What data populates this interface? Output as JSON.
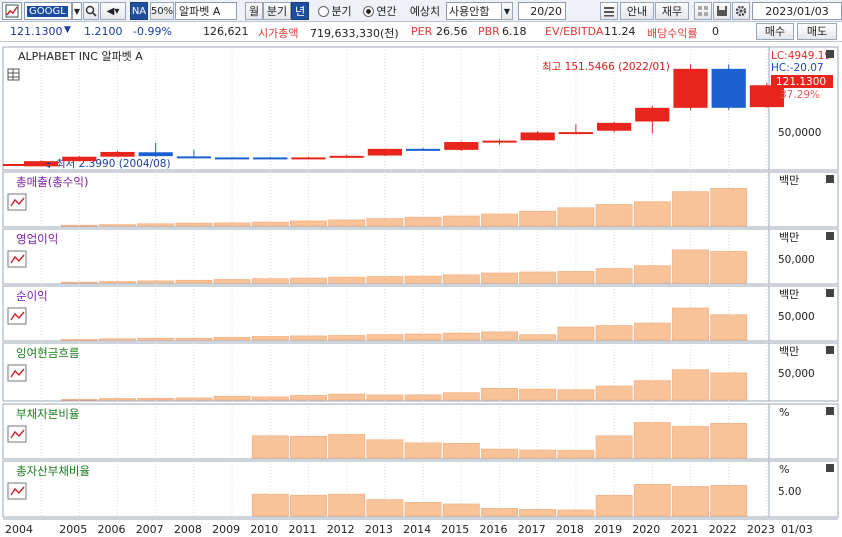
{
  "toolbar": {
    "ticker": "GOOGL",
    "na_label": "NA",
    "pct_label": "50%",
    "company": "알파벳 A",
    "month_label": "월",
    "quarter_label": "분기",
    "year_label": "년",
    "radio_quarter": "분기",
    "radio_annual": "연간",
    "forecast_label": "예상치",
    "forecast_select": "사용안함",
    "page_count": "20/20",
    "guide_label": "안내",
    "finance_label": "재무",
    "date": "2023/01/03"
  },
  "info": {
    "price": "121.1300",
    "change": "1.2100",
    "change_pct": "-0.99%",
    "volume": "126,621",
    "market_cap_label": "시가총액",
    "market_cap": "719,633,330(천)",
    "per_label": "PER",
    "per": "26.56",
    "pbr_label": "PBR",
    "pbr": "6.18",
    "ev_label": "EV/EBITDA",
    "ev": "11.24",
    "div_label": "배당수익률",
    "div": "0",
    "buy_label": "매수",
    "sell_label": "매도"
  },
  "chart": {
    "title": "ALPHABET INC 알파벳 A",
    "lc": "LC:4949.19",
    "hc": "HC:-20.07",
    "high_label": "최고 151.5466 (2022/01)",
    "low_label": "최저 2.3990 (2004/08)",
    "price_tag": "121.1300",
    "pct_tag": "37.29%",
    "axis_label": "50,0000"
  },
  "colors": {
    "up": "#e8251c",
    "down": "#1c5fd1",
    "bar": "#f9c39a",
    "bar_stroke": "#f2a978",
    "panel_title": "#7b1fa2",
    "panel_title_green": "#1b7d1b"
  },
  "chart_data": [
    {
      "type": "bar",
      "name": "candles",
      "x": [
        "2004",
        "2005",
        "2006",
        "2007",
        "2008",
        "2009",
        "2010",
        "2011",
        "2012",
        "2013",
        "2014",
        "2015",
        "2016",
        "2017",
        "2018",
        "2019",
        "2020",
        "2021",
        "2022",
        "2023"
      ],
      "open": [
        2.4,
        10.0,
        16.5,
        23.0,
        17.0,
        15.5,
        15.5,
        15.0,
        15.5,
        18.2,
        28.0,
        26.5,
        38.0,
        40.5,
        52.0,
        54.5,
        68.0,
        88.0,
        145.0,
        89.0
      ],
      "close": [
        10.0,
        16.5,
        23.5,
        17.3,
        15.5,
        14.9,
        14.9,
        15.5,
        17.8,
        28.0,
        26.5,
        38.0,
        40.0,
        52.0,
        52.5,
        66.0,
        88.0,
        145.0,
        88.0,
        121.0
      ],
      "high": [
        11.0,
        17.5,
        25.0,
        37.0,
        26.5,
        16.0,
        16.0,
        16.5,
        19.5,
        28.0,
        29.5,
        39.0,
        42.0,
        54.0,
        64.0,
        68.0,
        91.0,
        151.5,
        151.5,
        125.0
      ],
      "low": [
        2.399,
        9.5,
        15.5,
        16.0,
        15.0,
        14.0,
        14.0,
        14.0,
        15.0,
        17.5,
        25.0,
        25.0,
        34.0,
        40.0,
        49.0,
        52.0,
        50.5,
        85.0,
        85.0,
        88.0
      ]
    },
    {
      "type": "bar",
      "name": "총매출(총수익)",
      "unit": "백만",
      "x": [
        "2005",
        "2006",
        "2007",
        "2008",
        "2009",
        "2010",
        "2011",
        "2012",
        "2013",
        "2014",
        "2015",
        "2016",
        "2017",
        "2018",
        "2019",
        "2020",
        "2021",
        "2022"
      ],
      "values": [
        6139,
        10605,
        16594,
        21796,
        23651,
        29321,
        37905,
        46039,
        55519,
        66001,
        74989,
        90272,
        110855,
        136819,
        161857,
        182527,
        257637,
        282836
      ]
    },
    {
      "type": "bar",
      "name": "영업이익",
      "unit": "백만",
      "tick": "50,000",
      "x": [
        "2005",
        "2006",
        "2007",
        "2008",
        "2009",
        "2010",
        "2011",
        "2012",
        "2013",
        "2014",
        "2015",
        "2016",
        "2017",
        "2018",
        "2019",
        "2020",
        "2021",
        "2022"
      ],
      "values": [
        2017,
        3550,
        5084,
        6632,
        8312,
        10381,
        11742,
        13834,
        15403,
        16496,
        19360,
        23716,
        26146,
        27524,
        34231,
        41224,
        78714,
        74842
      ]
    },
    {
      "type": "bar",
      "name": "순이익",
      "unit": "백만",
      "tick": "50,000",
      "x": [
        "2005",
        "2006",
        "2007",
        "2008",
        "2009",
        "2010",
        "2011",
        "2012",
        "2013",
        "2014",
        "2015",
        "2016",
        "2017",
        "2018",
        "2019",
        "2020",
        "2021",
        "2022"
      ],
      "values": [
        1465,
        3077,
        4204,
        4227,
        6520,
        8505,
        9737,
        10737,
        12920,
        14136,
        16348,
        19478,
        12662,
        30736,
        34343,
        40269,
        76033,
        59972
      ]
    },
    {
      "type": "bar",
      "name": "잉여현금흐름",
      "unit": "백만",
      "tick": "50,000",
      "x": [
        "2005",
        "2006",
        "2007",
        "2008",
        "2009",
        "2010",
        "2011",
        "2012",
        "2013",
        "2014",
        "2015",
        "2016",
        "2017",
        "2018",
        "2019",
        "2020",
        "2021",
        "2022"
      ],
      "values": [
        1660,
        3400,
        3770,
        4560,
        8460,
        7140,
        9990,
        13210,
        11310,
        11420,
        16110,
        25820,
        23910,
        22830,
        30970,
        42840,
        67010,
        60010
      ]
    },
    {
      "type": "bar",
      "name": "부채자본비율",
      "unit": "%",
      "x": [
        "2010",
        "2011",
        "2012",
        "2013",
        "2014",
        "2015",
        "2016",
        "2017",
        "2018",
        "2019",
        "2020",
        "2021",
        "2022"
      ],
      "values": [
        5.0,
        4.9,
        5.3,
        4.1,
        3.4,
        3.3,
        2.0,
        1.8,
        1.7,
        5.0,
        8.0,
        7.1,
        7.8
      ]
    },
    {
      "type": "bar",
      "name": "총자산부채비율",
      "unit": "%",
      "tick": "5.00",
      "x": [
        "2010",
        "2011",
        "2012",
        "2013",
        "2014",
        "2015",
        "2016",
        "2017",
        "2018",
        "2019",
        "2020",
        "2021",
        "2022"
      ],
      "values": [
        4.0,
        3.8,
        4.0,
        3.0,
        2.5,
        2.2,
        1.4,
        1.2,
        1.1,
        3.8,
        5.8,
        5.4,
        5.6
      ]
    }
  ],
  "x_axis": [
    "2004",
    "2005",
    "2006",
    "2007",
    "2008",
    "2009",
    "2010",
    "2011",
    "2012",
    "2013",
    "2014",
    "2015",
    "2016",
    "2017",
    "2018",
    "2019",
    "2020",
    "2021",
    "2022",
    "2023",
    "01/03"
  ]
}
